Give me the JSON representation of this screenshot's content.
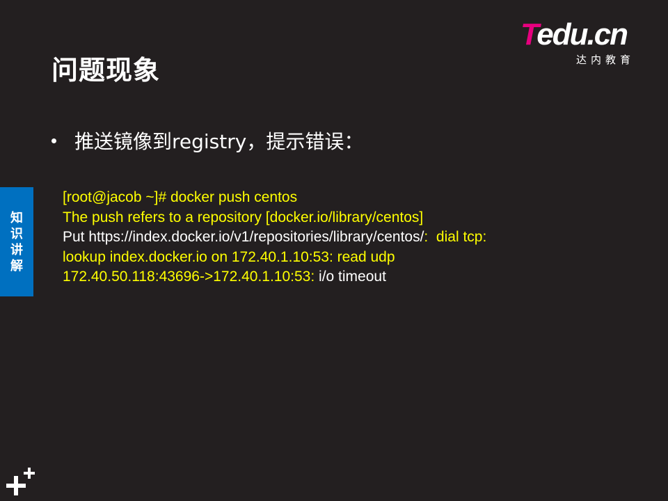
{
  "slide": {
    "title": "问题现象",
    "bullet": "推送镜像到registry，提示错误："
  },
  "logo": {
    "mark_t": "T",
    "mark_edu": "edu",
    "mark_cn": ".cn",
    "subtitle": "达内教育"
  },
  "side_tab": {
    "chars": [
      "知",
      "识",
      "讲",
      "解"
    ]
  },
  "code": {
    "line1": "[root@jacob ~]# docker push centos",
    "line2": "The push refers to a repository [docker.io/library/centos]",
    "line3_white": "Put https://index.docker.io/v1/repositories/library/centos/",
    "line3_yellow": ":  dial tcp:",
    "line4": "lookup index.docker.io on 172.40.1.10:53: read udp",
    "line5_yellow": "172.40.50.118:43696->172.40.1.10:53: ",
    "line5_white": "i/o timeout"
  },
  "colors": {
    "background": "#231f20",
    "code_highlight": "#ffff00",
    "tab_blue": "#0070c0",
    "logo_pink": "#e6007e"
  },
  "icons": {
    "corner": "plus-plus-icon"
  }
}
